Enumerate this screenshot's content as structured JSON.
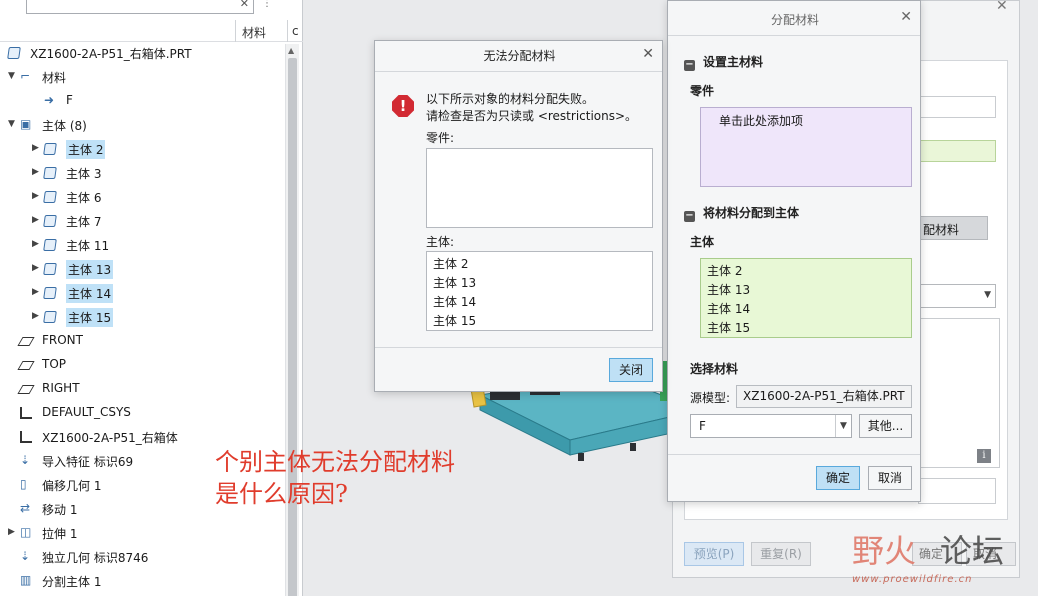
{
  "tree": {
    "columns": {
      "material": "材料",
      "c": "c"
    },
    "rows": [
      {
        "label": "XZ1600-2A-P51_右箱体.PRT",
        "indent": 0,
        "arrow": "",
        "icon": "body-icon",
        "hl": false
      },
      {
        "label": "材料",
        "indent": 1,
        "arrow": "▼",
        "icon": "material-folder-icon",
        "hl": false
      },
      {
        "label": "F",
        "indent": 2,
        "arrow": "",
        "icon": "material-assigned-icon",
        "hl": false
      },
      {
        "label": "主体 (8)",
        "indent": 1,
        "arrow": "▼",
        "icon": "bodies-folder-icon",
        "hl": false
      },
      {
        "label": "主体 2",
        "indent": 2,
        "arrow": "▶",
        "icon": "body-icon",
        "hl": true
      },
      {
        "label": "主体 3",
        "indent": 2,
        "arrow": "▶",
        "icon": "body-icon",
        "hl": false
      },
      {
        "label": "主体 6",
        "indent": 2,
        "arrow": "▶",
        "icon": "body-icon",
        "hl": false
      },
      {
        "label": "主体 7",
        "indent": 2,
        "arrow": "▶",
        "icon": "body-icon",
        "hl": false
      },
      {
        "label": "主体 11",
        "indent": 2,
        "arrow": "▶",
        "icon": "body-icon",
        "hl": false
      },
      {
        "label": "主体 13",
        "indent": 2,
        "arrow": "▶",
        "icon": "body-icon",
        "hl": true
      },
      {
        "label": "主体 14",
        "indent": 2,
        "arrow": "▶",
        "icon": "body-icon",
        "hl": true
      },
      {
        "label": "主体 15",
        "indent": 2,
        "arrow": "▶",
        "icon": "body-icon",
        "hl": true
      },
      {
        "label": "FRONT",
        "indent": 1,
        "arrow": "",
        "icon": "datum-plane-icon",
        "hl": false
      },
      {
        "label": "TOP",
        "indent": 1,
        "arrow": "",
        "icon": "datum-plane-icon",
        "hl": false
      },
      {
        "label": "RIGHT",
        "indent": 1,
        "arrow": "",
        "icon": "datum-plane-icon",
        "hl": false
      },
      {
        "label": "DEFAULT_CSYS",
        "indent": 1,
        "arrow": "",
        "icon": "csys-icon",
        "hl": false
      },
      {
        "label": "XZ1600-2A-P51_右箱体",
        "indent": 1,
        "arrow": "",
        "icon": "csys-icon",
        "hl": false
      },
      {
        "label": "导入特征 标识69",
        "indent": 1,
        "arrow": "",
        "icon": "import-feature-icon",
        "hl": false
      },
      {
        "label": "偏移几何 1",
        "indent": 1,
        "arrow": "",
        "icon": "offset-geometry-icon",
        "hl": false
      },
      {
        "label": "移动 1",
        "indent": 1,
        "arrow": "",
        "icon": "move-icon",
        "hl": false
      },
      {
        "label": "拉伸 1",
        "indent": 1,
        "arrow": "▶",
        "icon": "extrude-icon",
        "hl": false
      },
      {
        "label": "独立几何 标识8746",
        "indent": 1,
        "arrow": "",
        "icon": "independent-geometry-icon",
        "hl": false
      },
      {
        "label": "分割主体 1",
        "indent": 1,
        "arrow": "",
        "icon": "split-body-icon",
        "hl": false
      }
    ]
  },
  "annotation": {
    "line1": "个别主体无法分配材料",
    "line2": "是什么原因?"
  },
  "error_dialog": {
    "title": "无法分配材料",
    "message_line1": "以下所示对象的材料分配失败。",
    "message_line2": "请检查是否为只读或 <restrictions>。",
    "parts_label": "零件:",
    "bodies_label": "主体:",
    "bodies": [
      "主体 2",
      "主体 13",
      "主体 14",
      "主体 15"
    ],
    "close_label": "关闭"
  },
  "assign_dialog": {
    "title": "分配材料",
    "section_set_master": "设置主材料",
    "parts_label": "零件",
    "parts_placeholder": "单击此处添加项",
    "section_assign_bodies": "将材料分配到主体",
    "bodies_label": "主体",
    "bodies": [
      "主体 2",
      "主体 13",
      "主体 14",
      "主体 15"
    ],
    "select_material_label": "选择材料",
    "source_model_label": "源模型:",
    "source_model_value": "XZ1600-2A-P51_右箱体.PRT",
    "material_value": "F",
    "other_label": "其他...",
    "ok_label": "确定",
    "cancel_label": "取消"
  },
  "bg_dialog": {
    "assign_button_partial": "配材料",
    "preview_label": "预览(P)",
    "reset_label": "重复(R)",
    "ok_partial": "确定",
    "cancel_partial": "取消"
  },
  "watermark": {
    "cn1": "野火",
    "cn2": "论坛",
    "url": "www.proewildfire.cn"
  },
  "colors": {
    "highlight": "#bfe1f7",
    "annotation": "#e03c2c",
    "error": "#d22a33",
    "primary_button": "#bfe0f5"
  }
}
